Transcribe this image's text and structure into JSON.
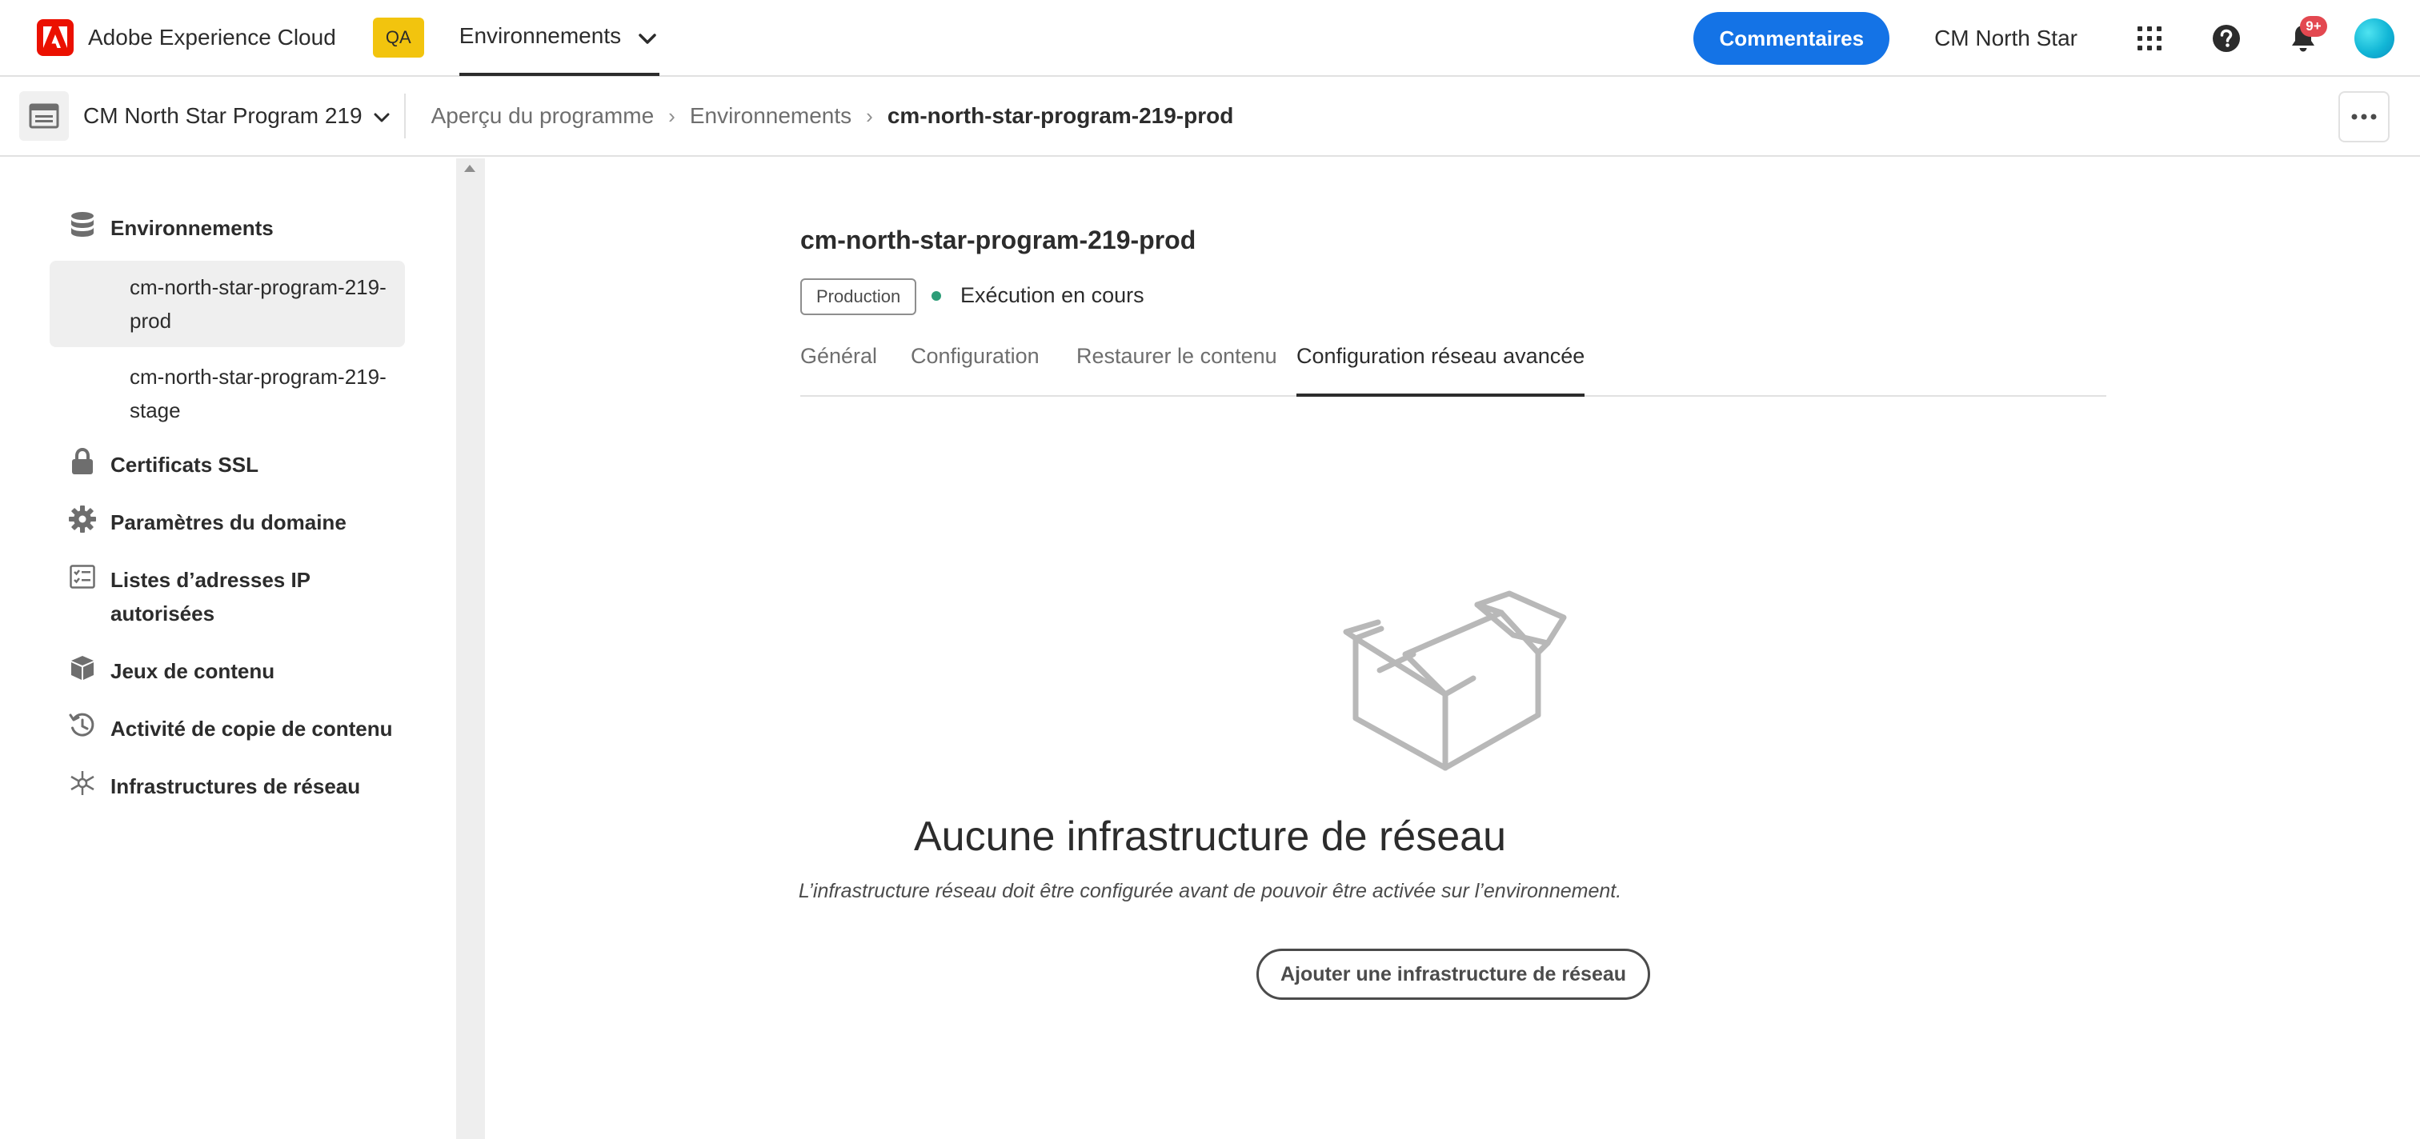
{
  "header": {
    "brand": "Adobe Experience Cloud",
    "env_badge": "QA",
    "nav_label": "Environnements",
    "feedback_label": "Commentaires",
    "org_name": "CM North Star",
    "notification_count": "9+",
    "icons": [
      "adobe-logo-icon",
      "chevron-down-icon",
      "apps-grid-icon",
      "help-icon",
      "bell-icon",
      "avatar"
    ]
  },
  "subbar": {
    "program_name": "CM North Star Program 219",
    "breadcrumbs": [
      "Aperçu du programme",
      "Environnements",
      "cm-north-star-program-219-prod"
    ]
  },
  "sidebar": {
    "environments_label": "Environnements",
    "env_items": [
      {
        "label": "cm-north-star-program-219-prod",
        "line1": "cm-north-star-program-219-",
        "line2": "prod",
        "active": true
      },
      {
        "label": "cm-north-star-program-219-stage",
        "line1": "cm-north-star-program-219-",
        "line2": "stage",
        "active": false
      }
    ],
    "items": [
      {
        "label": "Certificats SSL",
        "icon": "lock-icon"
      },
      {
        "label": "Paramètres du domaine",
        "icon": "gear-icon"
      },
      {
        "label": "Listes d’adresses IP autorisées",
        "line1": "Listes d’adresses IP",
        "line2": "autorisées",
        "icon": "checklist-icon"
      },
      {
        "label": "Jeux de contenu",
        "icon": "package-icon"
      },
      {
        "label": "Activité de copie de contenu",
        "icon": "history-icon"
      },
      {
        "label": "Infrastructures de réseau",
        "icon": "network-icon"
      }
    ]
  },
  "main": {
    "env_title": "cm-north-star-program-219-prod",
    "env_type": "Production",
    "status_text": "Exécution en cours",
    "status_color": "#2d9d78",
    "tabs": [
      "Général",
      "Configuration",
      "Restaurer le contenu",
      "Configuration réseau avancée"
    ],
    "selected_tab": "Configuration réseau avancée",
    "empty_state": {
      "illustration": "open-box-icon",
      "title": "Aucune infrastructure de réseau",
      "description": "L’infrastructure réseau doit être configurée avant de pouvoir être activée sur l’environnement.",
      "button_label": "Ajouter une infrastructure de réseau"
    }
  },
  "colors": {
    "accent": "#1473e6",
    "adobe_red": "#eb1000",
    "qa_yellow": "#f2c40e",
    "notification_red": "#e34850"
  }
}
